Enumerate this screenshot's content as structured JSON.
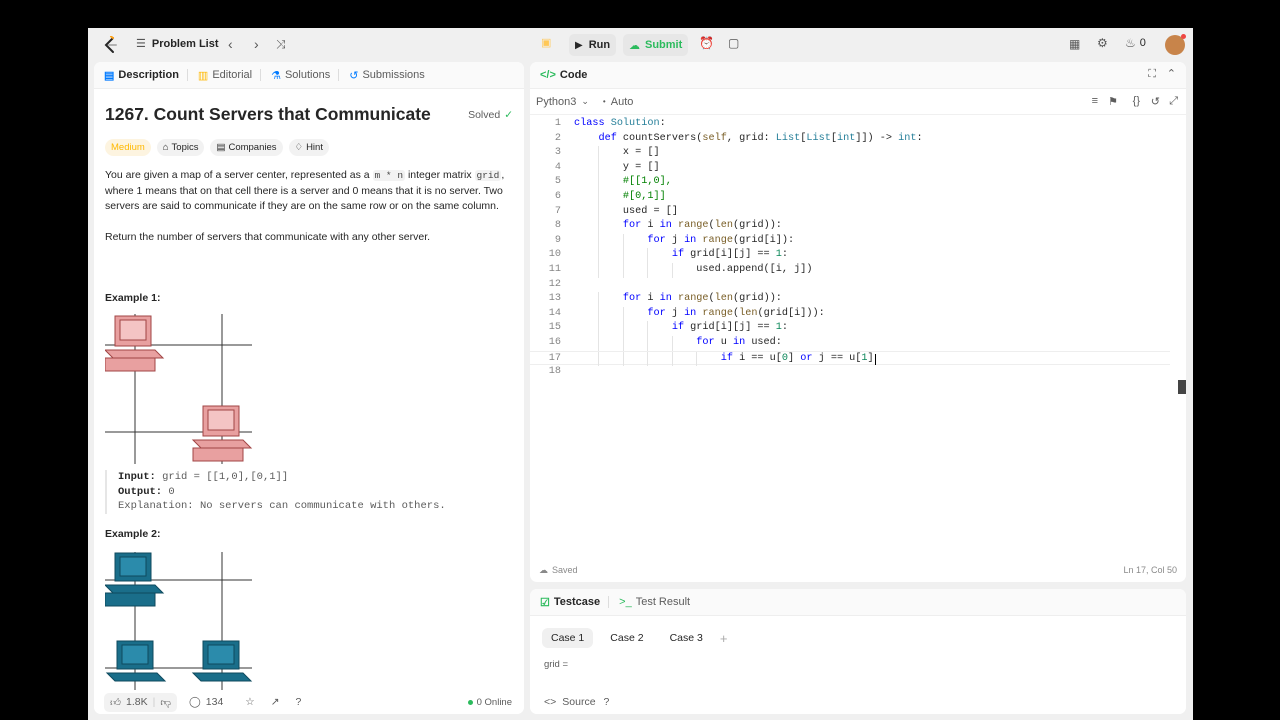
{
  "nav": {
    "problem_list": "Problem List",
    "run": "Run",
    "submit": "Submit",
    "streak": "0"
  },
  "left": {
    "tabs": [
      {
        "label": "Description",
        "icon": "document-icon"
      },
      {
        "label": "Editorial",
        "icon": "book-icon"
      },
      {
        "label": "Solutions",
        "icon": "flask-icon"
      },
      {
        "label": "Submissions",
        "icon": "history-icon"
      }
    ],
    "title": "1267. Count Servers that Communicate",
    "status": "Solved",
    "chips": [
      "Medium",
      "Topics",
      "Companies",
      "Hint"
    ],
    "para1_a": "You are given a map of a server center, represented as a ",
    "para1_code1": "m * n",
    "para1_b": " integer matrix ",
    "para1_code2": "grid",
    "para1_c": ", where 1 means that on that cell there is a server and 0 means that it is no server. Two servers are said to communicate if they are on the same row or on the same column.",
    "para2": "Return the number of servers that communicate with any other server.",
    "example1_title": "Example 1:",
    "example1_input_label": "Input:",
    "example1_input": "grid = [[1,0],[0,1]]",
    "example1_output_label": "Output:",
    "example1_output": "0",
    "example1_expl_label": "Explanation:",
    "example1_expl": "No servers can communicate with others.",
    "example2_title": "Example 2:",
    "likes": "1.8K",
    "comments": "134",
    "online": "0 Online"
  },
  "code": {
    "header": "Code",
    "language": "Python3",
    "mode": "Auto",
    "saved": "Saved",
    "cursor": "Ln 17, Col 50",
    "lines": [
      "class Solution:",
      "    def countServers(self, grid: List[List[int]]) -> int:",
      "        x = []",
      "        y = []",
      "        #[[1,0],",
      "        #[0,1]]",
      "        used = []",
      "        for i in range(len(grid)):",
      "            for j in range(grid[i]):",
      "                if grid[i][j] == 1:",
      "                    used.append([i, j])",
      "",
      "        for i in range(len(grid)):",
      "            for j in range(len(grid[i])):",
      "                if grid[i][j] == 1:",
      "                    for u in used:",
      "                        if i == u[0] or j == u[1]",
      ""
    ]
  },
  "tests": {
    "tabs": [
      "Testcase",
      "Test Result"
    ],
    "cases": [
      "Case 1",
      "Case 2",
      "Case 3"
    ],
    "param": "grid =",
    "source": "Source"
  },
  "colors": {
    "accent_green": "#2cbb5d",
    "medium": "#ffb800",
    "server_red": "#e8a0a0",
    "server_blue": "#1a6e8a"
  }
}
